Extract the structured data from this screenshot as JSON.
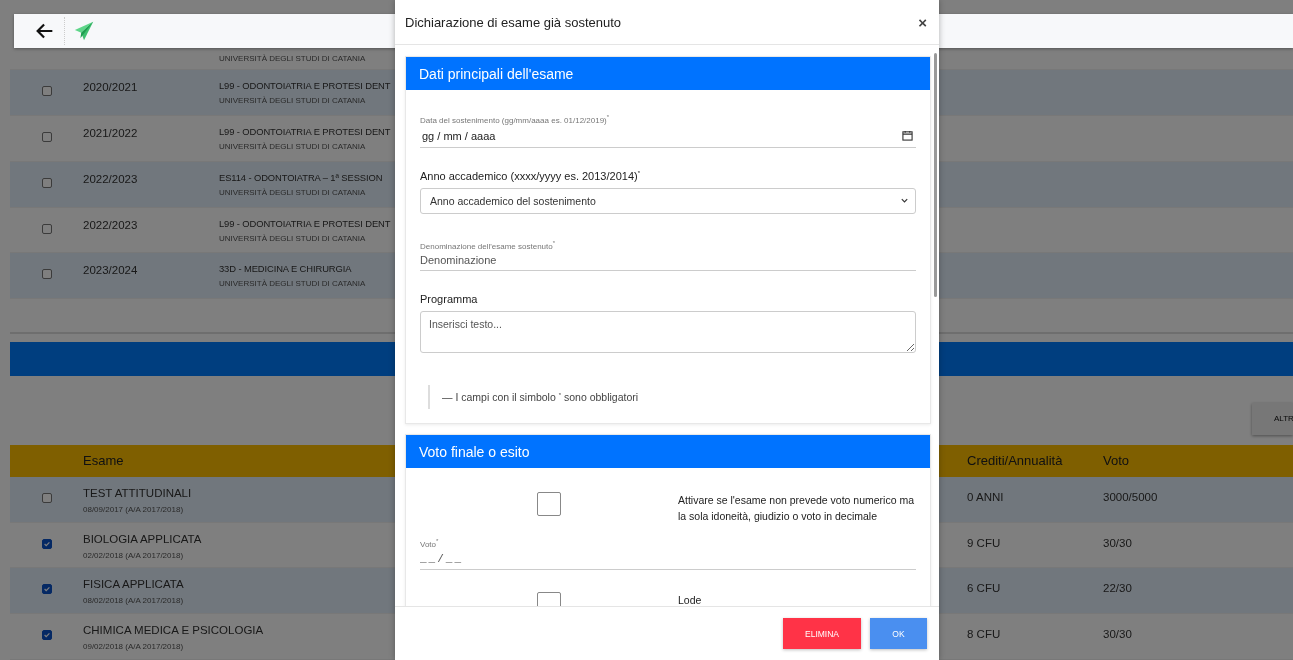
{
  "courses": {
    "partial_row": {
      "university": "UNIVERSITÀ DEGLI STUDI DI CATANIA"
    },
    "rows": [
      {
        "checked": false,
        "year": "2020/2021",
        "title": "L99 - ODONTOIATRIA E PROTESI DENT",
        "university": "UNIVERSITÀ DEGLI STUDI DI CATANIA"
      },
      {
        "checked": false,
        "year": "2021/2022",
        "title": "L99 - ODONTOIATRIA E PROTESI DENT",
        "university": "UNIVERSITÀ DEGLI STUDI DI CATANIA"
      },
      {
        "checked": false,
        "year": "2022/2023",
        "title": "ES114 - ODONTOIATRA – 1ª SESSION",
        "university": "UNIVERSITÀ DEGLI STUDI DI CATANIA"
      },
      {
        "checked": false,
        "year": "2022/2023",
        "title": "L99 - ODONTOIATRIA E PROTESI DENT",
        "university": "UNIVERSITÀ DEGLI STUDI DI CATANIA"
      },
      {
        "checked": false,
        "year": "2023/2024",
        "title": "33D - MEDICINA E CHIRURGIA",
        "university": "UNIVERSITÀ DEGLI STUDI DI CATANIA"
      }
    ]
  },
  "exams": {
    "button": "ALTR",
    "columns": [
      "Esame",
      "Crediti/Annualità",
      "Voto"
    ],
    "rows": [
      {
        "checked": false,
        "name": "TEST ATTITUDINALI",
        "date": "08/09/2017 (A/A 2017/2018)",
        "credits": "0 ANNI",
        "grade": "3000/5000"
      },
      {
        "checked": true,
        "name": "BIOLOGIA APPLICATA",
        "date": "02/02/2018 (A/A 2017/2018)",
        "credits": "9 CFU",
        "grade": "30/30"
      },
      {
        "checked": true,
        "name": "FISICA APPLICATA",
        "date": "08/02/2018 (A/A 2017/2018)",
        "credits": "6 CFU",
        "grade": "22/30"
      },
      {
        "checked": true,
        "name": "CHIMICA MEDICA E PSICOLOGIA",
        "date": "09/02/2018 (A/A 2017/2018)",
        "credits": "8 CFU",
        "grade": "30/30"
      }
    ]
  },
  "dialog": {
    "title": "Dichiarazione di esame già sostenuto",
    "close": "×",
    "sections": [
      {
        "title": "Dati principali dell'esame",
        "fields": [
          {
            "kind": "date",
            "label": "Data del sostenimento (gg/mm/aaaa es. 01/12/2019)$^{*}$",
            "value": "gg / mm / aaaa"
          },
          {
            "kind": "select",
            "label": "Anno accademico (xxxx/yyyy es. 2013/2014)$^{*}$",
            "value": "Anno accademico del sostenimento"
          },
          {
            "kind": "text",
            "label": "Denominazione dell'esame sostenuto$^{*}$",
            "placeholder": "Denominazione"
          },
          {
            "kind": "textarea",
            "label": "Programma",
            "placeholder": "Inserisci testo..."
          },
          {
            "kind": "note",
            "text": "— I campi con il simbolo $^{*}$ sono obbligatori"
          }
        ]
      },
      {
        "title": "Voto finale o esito",
        "fields": [
          {
            "kind": "checkbox",
            "checked": false,
            "label": "Attivare se l'esame non prevede voto numerico ma la sola idoneità, giudizio o voto in decimale"
          },
          {
            "kind": "text",
            "label": "Voto$^{*}$",
            "placeholder": "__/__"
          },
          {
            "kind": "checkbox",
            "checked": false,
            "label": "Lode"
          }
        ]
      }
    ],
    "buttons": [
      {
        "kind": "danger",
        "label": "ELIMINA"
      },
      {
        "kind": "primary",
        "label": "OK"
      }
    ]
  }
}
